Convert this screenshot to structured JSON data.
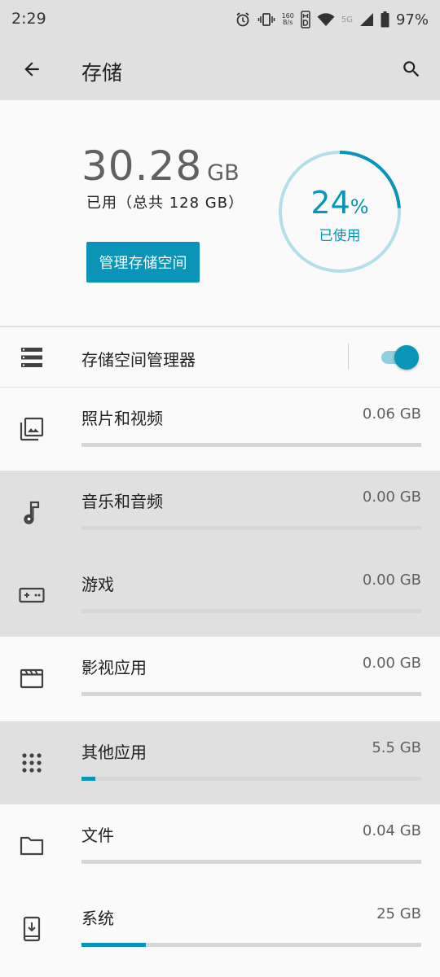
{
  "status_bar": {
    "time": "2:29",
    "speed_value": "160",
    "speed_unit": "B/s",
    "network": "5G",
    "battery": "97%",
    "icons": [
      "alarm-icon",
      "vibrate-icon",
      "data-speed-icon",
      "hd-icon",
      "wifi-icon",
      "signal-icon",
      "battery-icon"
    ]
  },
  "app_bar": {
    "title": "存储",
    "back_icon": "arrow-back-icon",
    "search_icon": "search-icon"
  },
  "summary": {
    "used_value": "30.28",
    "used_unit": "GB",
    "used_sub": "已用（总共 128 GB）",
    "manage_button": "管理存储空间",
    "percent": "24",
    "percent_symbol": "%",
    "percent_label": "已使用",
    "percent_fraction": 0.24
  },
  "storage_manager": {
    "label": "存储空间管理器",
    "icon": "storage-list-icon",
    "enabled": true
  },
  "categories": [
    {
      "label": "照片和视频",
      "size": "0.06 GB",
      "fraction": 0.0,
      "icon": "photo-library-icon"
    },
    {
      "label": "音乐和音频",
      "size": "0.00 GB",
      "fraction": 0.0,
      "icon": "music-note-icon"
    },
    {
      "label": "游戏",
      "size": "0.00 GB",
      "fraction": 0.0,
      "icon": "gamepad-icon"
    },
    {
      "label": "影视应用",
      "size": "0.00 GB",
      "fraction": 0.0,
      "icon": "movie-icon"
    },
    {
      "label": "其他应用",
      "size": "5.5 GB",
      "fraction": 0.04,
      "icon": "apps-icon"
    },
    {
      "label": "文件",
      "size": "0.04 GB",
      "fraction": 0.0,
      "icon": "folder-icon"
    },
    {
      "label": "系统",
      "size": "25 GB",
      "fraction": 0.19,
      "icon": "system-update-icon"
    }
  ],
  "colors": {
    "accent": "#0a94b8",
    "ring_track": "#b3dfe9",
    "bar_track": "#d6d6d6",
    "appbar_bg": "#e0e0e0"
  }
}
